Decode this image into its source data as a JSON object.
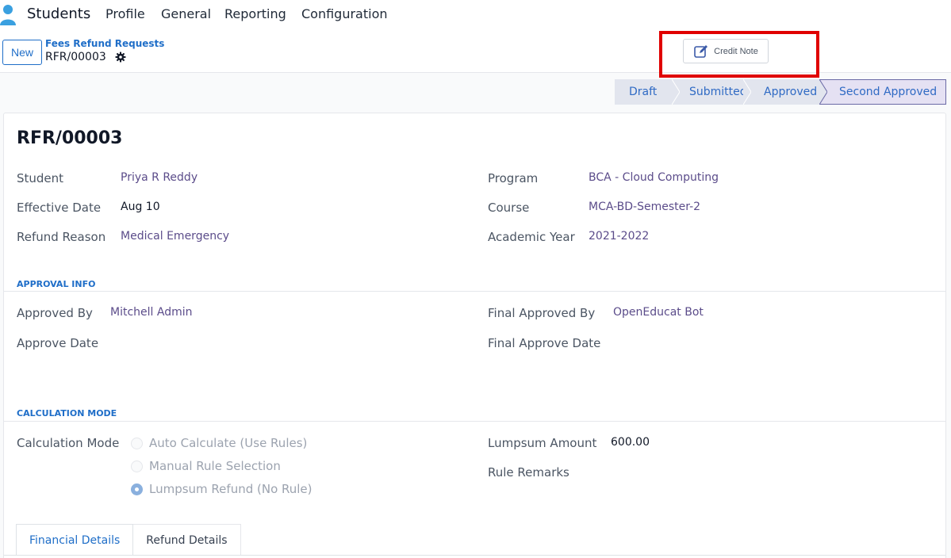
{
  "nav": {
    "brand": "Students",
    "items": [
      "Profile",
      "General",
      "Reporting",
      "Configuration"
    ]
  },
  "control": {
    "new_label": "New",
    "breadcrumb_parent": "Fees Refund Requests",
    "record_ref": "RFR/00003",
    "credit_note_label": "Credit Note"
  },
  "statusbar": {
    "stages": [
      "Draft",
      "Submitted",
      "Approved",
      "Second Approved"
    ],
    "current": "Second Approved"
  },
  "form": {
    "title": "RFR/00003",
    "left_fields": [
      {
        "label": "Student",
        "value": "Priya R Reddy"
      },
      {
        "label": "Effective Date",
        "value": "Aug 10"
      },
      {
        "label": "Refund Reason",
        "value": "Medical Emergency"
      }
    ],
    "right_fields": [
      {
        "label": "Program",
        "value": "BCA - Cloud Computing"
      },
      {
        "label": "Course",
        "value": "MCA-BD-Semester-2"
      },
      {
        "label": "Academic Year",
        "value": "2021-2022"
      }
    ],
    "approval": {
      "heading": "APPROVAL INFO",
      "approved_by_label": "Approved By",
      "approved_by": "Mitchell Admin",
      "approve_date_label": "Approve Date",
      "final_approved_by_label": "Final Approved By",
      "final_approved_by": "OpenEducat Bot",
      "final_approve_date_label": "Final Approve Date"
    },
    "calculation": {
      "heading": "CALCULATION MODE",
      "mode_label": "Calculation Mode",
      "options": [
        "Auto Calculate (Use Rules)",
        "Manual Rule Selection",
        "Lumpsum Refund (No Rule)"
      ],
      "selected": "Lumpsum Refund (No Rule)",
      "lumpsum_label": "Lumpsum Amount",
      "lumpsum_value": "600.00",
      "remarks_label": "Rule Remarks"
    },
    "tabs": [
      "Financial Details",
      "Refund Details"
    ]
  },
  "colors": {
    "accent": "#1f6ec8",
    "link": "#5b4c8a",
    "highlight": "#e00000",
    "status_active": "#e5e1f3"
  }
}
